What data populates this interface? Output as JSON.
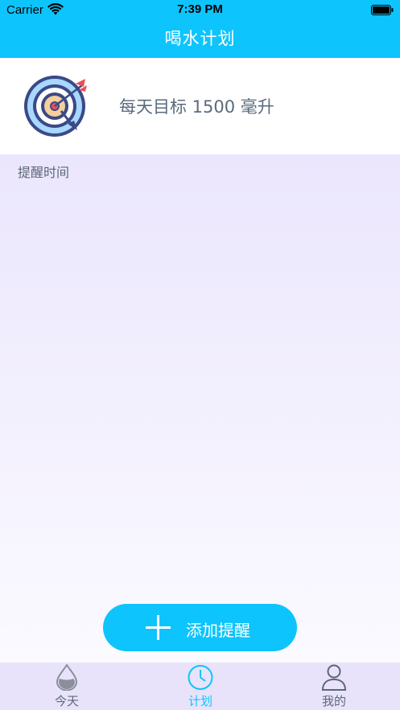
{
  "status_bar": {
    "carrier": "Carrier",
    "time": "7:39 PM"
  },
  "nav": {
    "title": "喝水计划"
  },
  "goal": {
    "text": "每天目标 1500 毫升"
  },
  "reminders": {
    "section_label": "提醒时间"
  },
  "add_button": {
    "label": "添加提醒"
  },
  "tabs": [
    {
      "label": "今天",
      "icon": "water-drop-icon",
      "active": false
    },
    {
      "label": "计划",
      "icon": "clock-icon",
      "active": true
    },
    {
      "label": "我的",
      "icon": "person-icon",
      "active": false
    }
  ],
  "colors": {
    "accent": "#0ec4fc",
    "text_muted": "#5c6778",
    "tab_bar_bg": "#e8e3fb"
  }
}
